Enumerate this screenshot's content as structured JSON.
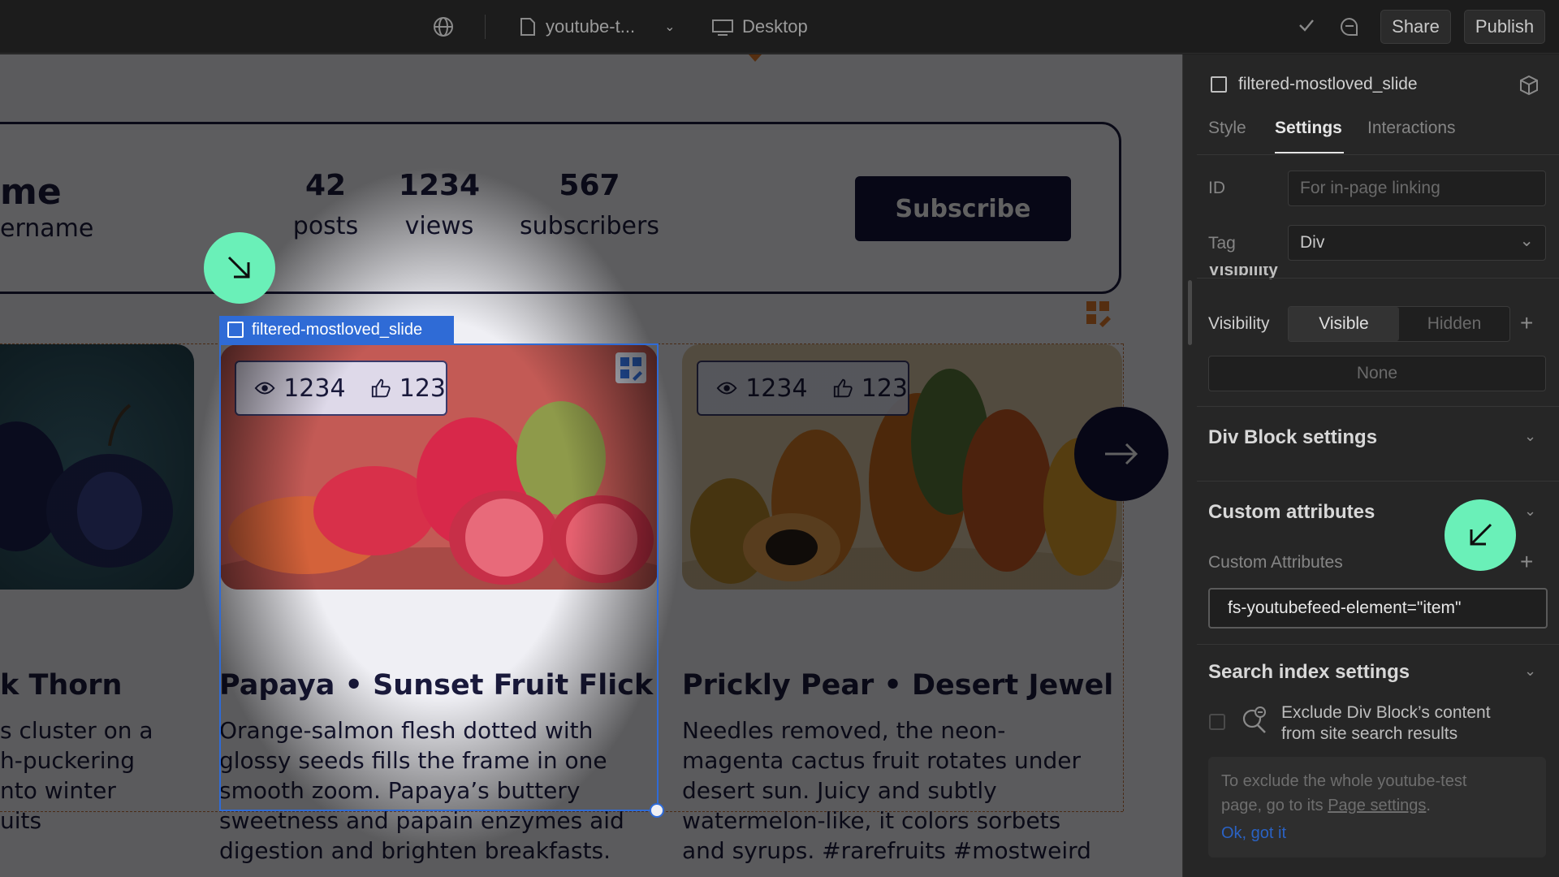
{
  "topbar": {
    "file_name": "youtube-t...",
    "device": "Desktop",
    "share_label": "Share",
    "publish_label": "Publish"
  },
  "canvas": {
    "profile": {
      "name_partial": "me",
      "username_partial": "ername",
      "stats": [
        {
          "value": "42",
          "label": "posts"
        },
        {
          "value": "1234",
          "label": "views"
        },
        {
          "value": "567",
          "label": "subscribers"
        }
      ],
      "subscribe_label": "Subscribe"
    },
    "selection_label": "filtered-mostloved_slide",
    "cards": [
      {
        "title": "k Thorn",
        "desc_lines": [
          "s cluster on a",
          "h-puckering",
          "nto winter",
          "uits"
        ]
      },
      {
        "views": "1234",
        "likes": "123",
        "title": "Papaya • Sunset Fruit Flick",
        "desc_lines": [
          "Orange-salmon flesh dotted with",
          "glossy seeds fills the frame in one",
          "smooth zoom. Papaya’s buttery",
          "sweetness and papain enzymes aid",
          "digestion and brighten breakfasts."
        ]
      },
      {
        "views": "1234",
        "likes": "123",
        "title": "Prickly Pear • Desert Jewel",
        "desc_lines": [
          "Needles removed, the neon-",
          "magenta cactus fruit rotates under",
          "desert sun. Juicy and subtly",
          "watermelon-like, it colors sorbets",
          "and syrups. #rarefruits #mostweird"
        ]
      }
    ]
  },
  "panel": {
    "element_name": "filtered-mostloved_slide",
    "tabs": [
      "Style",
      "Settings",
      "Interactions"
    ],
    "active_tab": "Settings",
    "id_label": "ID",
    "id_placeholder": "For in-page linking",
    "tag_label": "Tag",
    "tag_value": "Div",
    "visibility_partial": "Visibility",
    "visibility_label": "Visibility",
    "visible_option": "Visible",
    "hidden_option": "Hidden",
    "none_label": "None",
    "div_block_settings": "Div Block settings",
    "custom_attributes_title": "Custom attributes",
    "custom_attributes_label": "Custom Attributes",
    "attribute_value": "fs-youtubefeed-element=\"item\"",
    "search_index_title": "Search index settings",
    "exclude_line1": "Exclude Div Block’s content",
    "exclude_line2": "from site search results",
    "info_line1": "To exclude the whole youtube-test",
    "info_line2_prefix": "page, go to its ",
    "info_link": "Page settings",
    "info_line2_suffix": ".",
    "ok_label": "Ok, got it"
  },
  "colors": {
    "accent_selection": "#2f6bd6",
    "cursor_bubble": "#6af0b8",
    "brand_navy": "#12123a"
  }
}
